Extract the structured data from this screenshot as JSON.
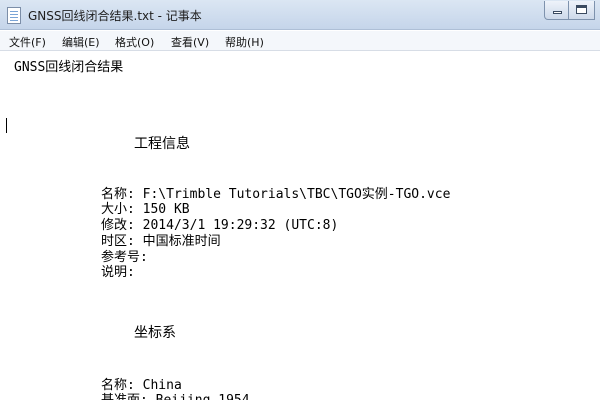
{
  "window": {
    "title": "GNSS回线闭合结果.txt - 记事本",
    "icon": "notepad-icon"
  },
  "menu": [
    {
      "label": "文件(F)"
    },
    {
      "label": "编辑(E)"
    },
    {
      "label": "格式(O)"
    },
    {
      "label": "查看(V)"
    },
    {
      "label": "帮助(H)"
    }
  ],
  "document": {
    "heading": "GNSS回线闭合结果",
    "project_info": {
      "title": "工程信息",
      "lines": [
        "名称: F:\\Trimble Tutorials\\TBC\\TGO实例-TGO.vce",
        "大小: 150 KB",
        "修改: 2014/3/1 19:29:32 (UTC:8)",
        "时区: 中国标准时间",
        "参考号:",
        "说明:"
      ]
    },
    "coordinate_system": {
      "title": "坐标系",
      "lines": [
        "名称: China",
        "基准面: Beijing 1954"
      ]
    }
  },
  "colors": {
    "titlebar": "#c5d5ea",
    "menubar": "#f4f7fb",
    "text": "#000000"
  }
}
